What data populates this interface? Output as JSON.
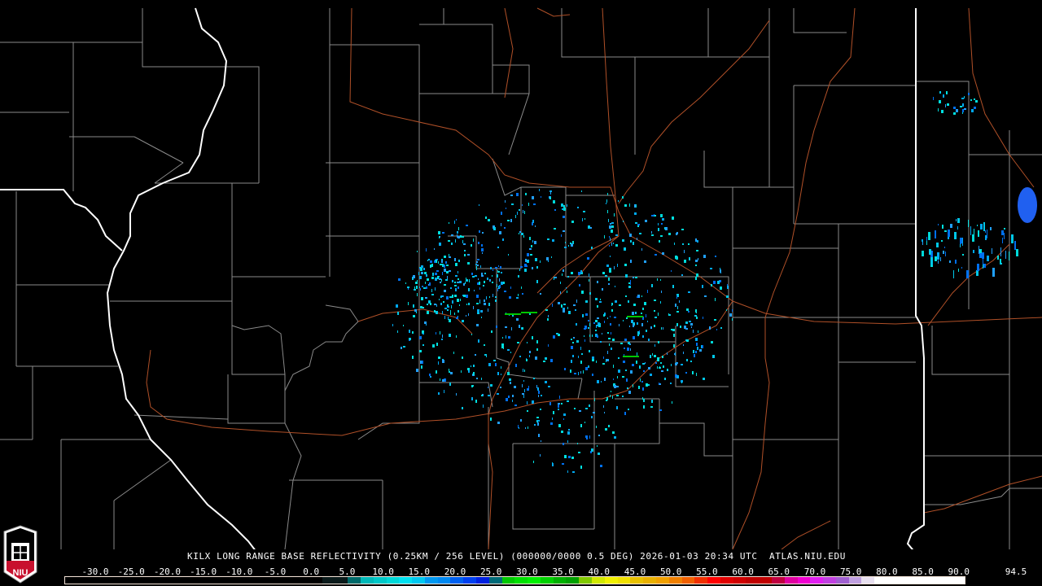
{
  "header": {
    "title": "KILX LONG RANGE BASE REFLECTIVITY (0.25KM / 256 LEVEL) (000000/0000 0.5 DEG) 2026-01-03 20:34 UTC  ATLAS.NIU.EDU"
  },
  "logo": {
    "text": "NIU",
    "colors": {
      "red": "#c8102e",
      "white": "#ffffff"
    }
  },
  "legend": {
    "ticks": [
      "-30.0",
      "-25.0",
      "-20.0",
      "-15.0",
      "-10.0",
      "-5.0",
      "0.0",
      "5.0",
      "10.0",
      "15.0",
      "20.0",
      "25.0",
      "30.0",
      "35.0",
      "40.0",
      "45.0",
      "50.0",
      "55.0",
      "60.0",
      "65.0",
      "70.0",
      "75.0",
      "80.0",
      "85.0",
      "90.0",
      "94.5"
    ],
    "colors": [
      "#000000",
      "#000000",
      "#000000",
      "#000000",
      "#000000",
      "#000000",
      "#000000",
      "#000000",
      "#000000",
      "#000000",
      "#000000",
      "#000000",
      "#000000",
      "#000000",
      "#000000",
      "#000000",
      "#000000",
      "#000000",
      "#000000",
      "#000000",
      "#0a1a1a",
      "#0a1a1a",
      "#006a6a",
      "#00b8b8",
      "#00c8c8",
      "#00d8d8",
      "#00e0f0",
      "#00c8f0",
      "#0098f0",
      "#0088f0",
      "#0060f0",
      "#0040f0",
      "#0020e0",
      "#006a78",
      "#00c800",
      "#00e000",
      "#00f000",
      "#00d000",
      "#00b000",
      "#00a000",
      "#80c800",
      "#d0e800",
      "#f0f000",
      "#f0e000",
      "#e8c000",
      "#e8b000",
      "#f0a000",
      "#f08000",
      "#f06000",
      "#f03000",
      "#ff0000",
      "#e00000",
      "#d00000",
      "#c00000",
      "#c00000",
      "#c00040",
      "#e000a0",
      "#f000d0",
      "#e020f0",
      "#c040e0",
      "#a060d0",
      "#c0a0e0",
      "#e8e0f0",
      "#ffffff",
      "#ffffff",
      "#ffffff",
      "#ffffff",
      "#ffffff",
      "#ffffff",
      "#ffffff"
    ]
  },
  "map": {
    "state_border_color": "#ffffff",
    "county_color": "#808080",
    "road_color": "#b05028"
  }
}
